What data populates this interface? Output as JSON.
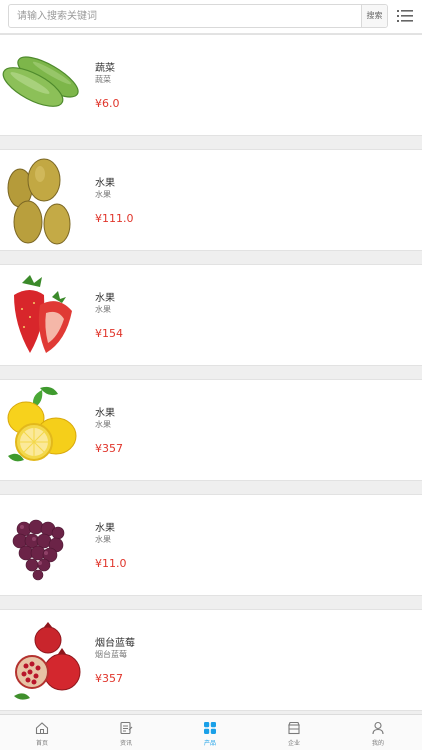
{
  "search": {
    "placeholder": "请输入搜索关键词",
    "button_label": "搜索"
  },
  "products": [
    {
      "title": "蔬菜",
      "subtitle": "蔬菜",
      "price": "¥6.0",
      "image": "cucumber"
    },
    {
      "title": "水果",
      "subtitle": "水果",
      "price": "¥111.0",
      "image": "kiwi"
    },
    {
      "title": "水果",
      "subtitle": "水果",
      "price": "¥154",
      "image": "strawberry"
    },
    {
      "title": "水果",
      "subtitle": "水果",
      "price": "¥357",
      "image": "lemon"
    },
    {
      "title": "水果",
      "subtitle": "水果",
      "price": "¥11.0",
      "image": "grape"
    },
    {
      "title": "烟台蓝莓",
      "subtitle": "烟台蓝莓",
      "price": "¥357",
      "image": "pomegranate"
    }
  ],
  "tabbar": {
    "items": [
      {
        "label": "首页",
        "icon": "home-icon",
        "active": false
      },
      {
        "label": "资讯",
        "icon": "news-icon",
        "active": false
      },
      {
        "label": "产品",
        "icon": "products-icon",
        "active": true
      },
      {
        "label": "企业",
        "icon": "company-icon",
        "active": false
      },
      {
        "label": "我的",
        "icon": "user-icon",
        "active": false
      }
    ]
  },
  "colors": {
    "price": "#e0352b",
    "accent": "#1aa0e8",
    "text": "#333333"
  }
}
